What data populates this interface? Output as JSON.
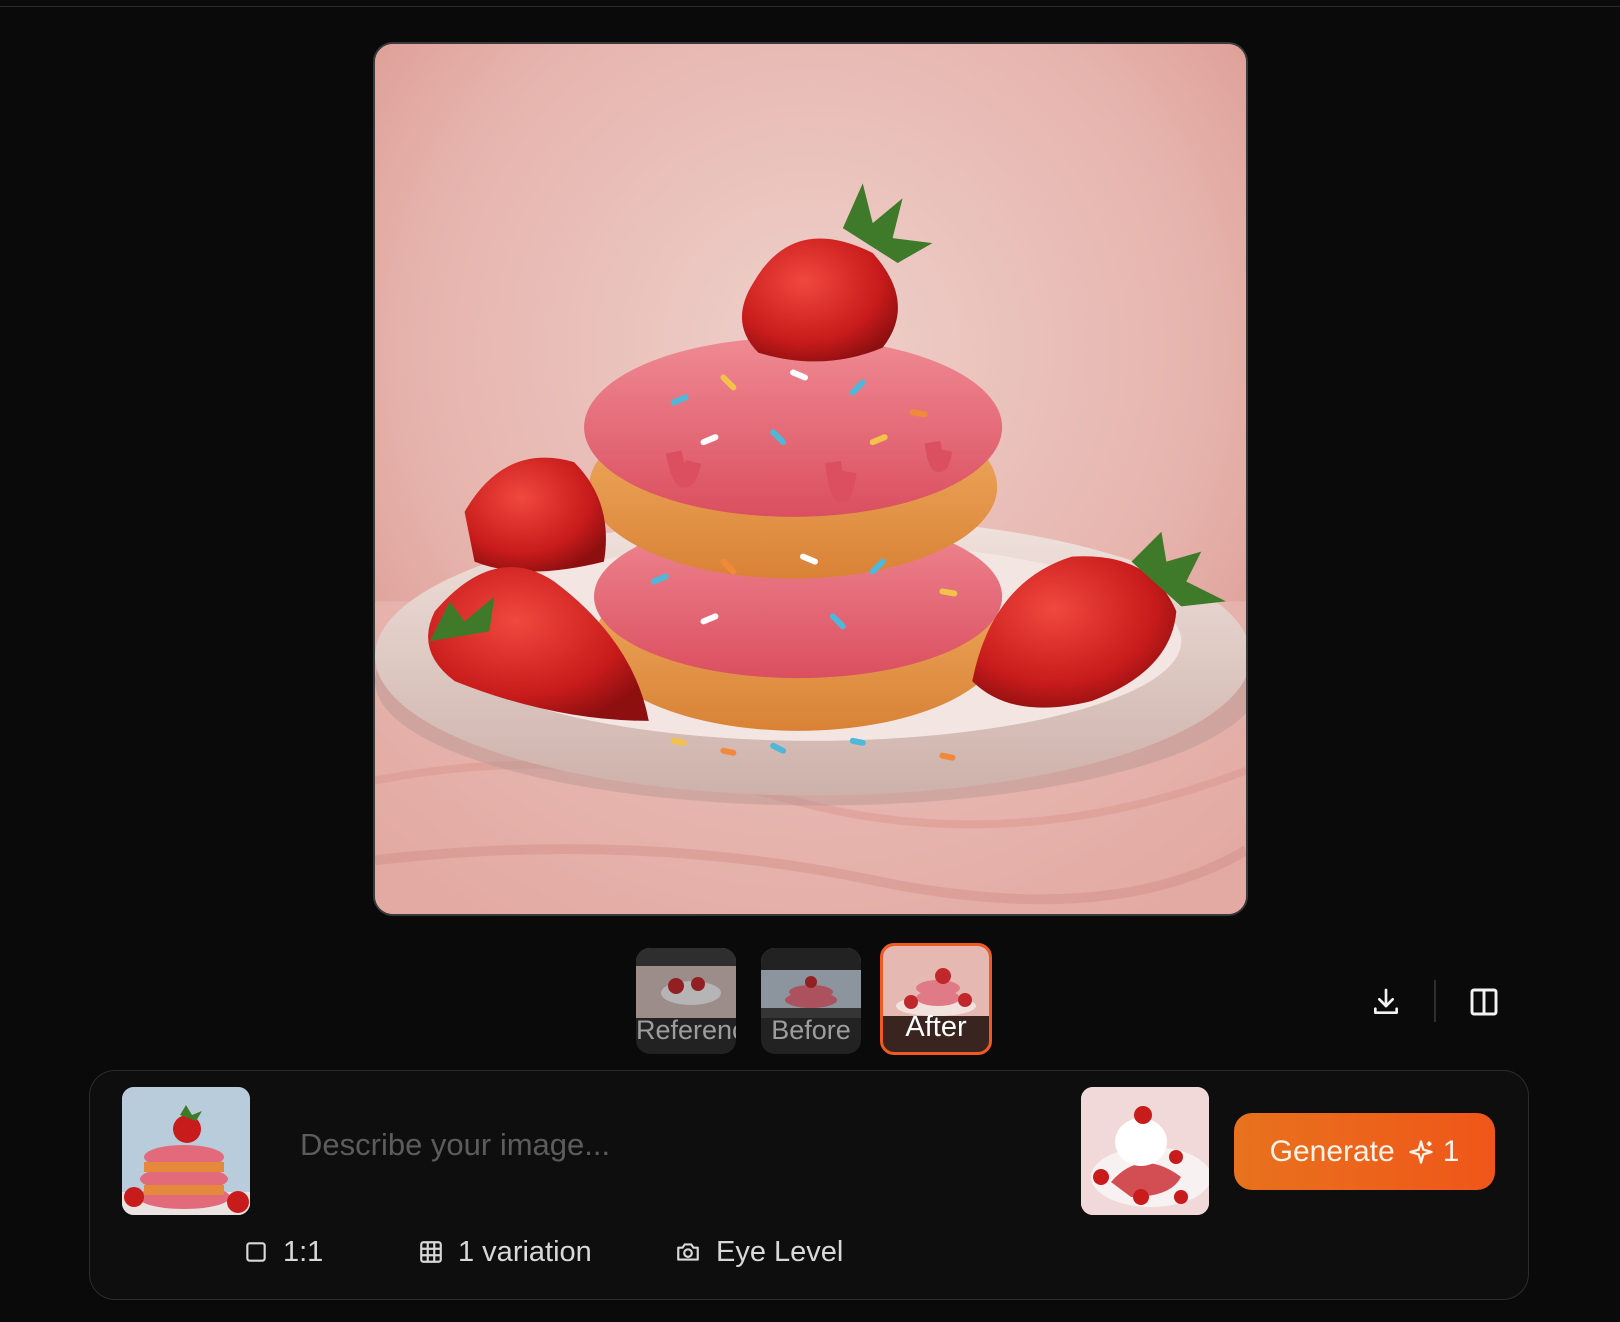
{
  "thumbnails": [
    {
      "label": "Reference"
    },
    {
      "label": "Before"
    },
    {
      "label": "After"
    }
  ],
  "toolbar": {
    "download_icon": "download-icon",
    "compare_icon": "compare-columns-icon"
  },
  "prompt": {
    "placeholder": "Describe your image...",
    "value": ""
  },
  "generate": {
    "label": "Generate",
    "credit_icon": "sparkle-icon",
    "credits": "1"
  },
  "options": {
    "aspect_ratio": "1:1",
    "variations": "1 variation",
    "camera_angle": "Eye Level"
  },
  "colors": {
    "accent": "#f05a22",
    "generate_start": "#e8721d",
    "generate_end": "#f0561a",
    "background": "#0a0a0a"
  }
}
